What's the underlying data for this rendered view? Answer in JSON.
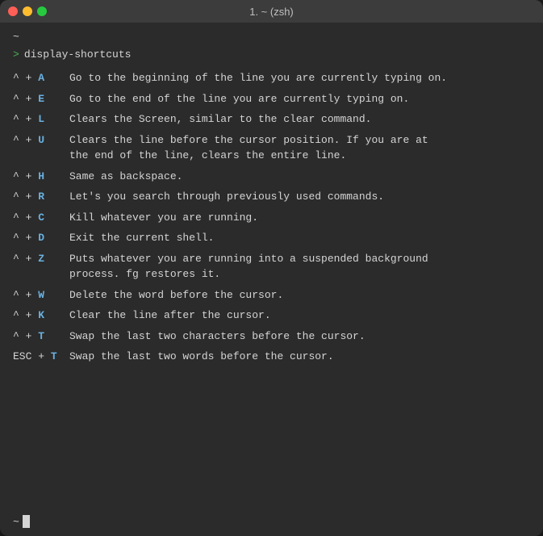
{
  "window": {
    "title": "1. ~ (zsh)"
  },
  "terminal": {
    "tilde": "~",
    "prompt_command": "display-shortcuts",
    "shortcuts": [
      {
        "key_display": "^ + A",
        "key_caret": "^",
        "key_plus": "+",
        "key_letter": "A",
        "key_type": "ctrl",
        "description": "Go to the beginning of the line you are currently typing on.",
        "description2": ""
      },
      {
        "key_display": "^ + E",
        "key_caret": "^",
        "key_plus": "+",
        "key_letter": "E",
        "key_type": "ctrl",
        "description": "Go to the end of the line you are currently typing on.",
        "description2": ""
      },
      {
        "key_display": "^ + L",
        "key_caret": "^",
        "key_plus": "+",
        "key_letter": "L",
        "key_type": "ctrl",
        "description": "Clears the Screen, similar to the clear command.",
        "description2": ""
      },
      {
        "key_display": "^ + U",
        "key_caret": "^",
        "key_plus": "+",
        "key_letter": "U",
        "key_type": "ctrl",
        "description": "Clears the line before the cursor position. If you are at",
        "description2": "the end of the line, clears the entire line."
      },
      {
        "key_display": "^ + H",
        "key_caret": "^",
        "key_plus": "+",
        "key_letter": "H",
        "key_type": "ctrl",
        "description": "Same as backspace.",
        "description2": ""
      },
      {
        "key_display": "^ + R",
        "key_caret": "^",
        "key_plus": "+",
        "key_letter": "R",
        "key_type": "ctrl",
        "description": "Let's you search through previously used commands.",
        "description2": ""
      },
      {
        "key_display": "^ + C",
        "key_caret": "^",
        "key_plus": "+",
        "key_letter": "C",
        "key_type": "ctrl",
        "description": "Kill whatever you are running.",
        "description2": ""
      },
      {
        "key_display": "^ + D",
        "key_caret": "^",
        "key_plus": "+",
        "key_letter": "D",
        "key_type": "ctrl",
        "description": "Exit the current shell.",
        "description2": ""
      },
      {
        "key_display": "^ + Z",
        "key_caret": "^",
        "key_plus": "+",
        "key_letter": "Z",
        "key_type": "ctrl",
        "description": "Puts whatever you are running into a suspended background",
        "description2": "process. fg restores it."
      },
      {
        "key_display": "^ + W",
        "key_caret": "^",
        "key_plus": "+",
        "key_letter": "W",
        "key_type": "ctrl",
        "description": "Delete the word before the cursor.",
        "description2": ""
      },
      {
        "key_display": "^ + K",
        "key_caret": "^",
        "key_plus": "+",
        "key_letter": "K",
        "key_type": "ctrl",
        "description": "Clear the line after the cursor.",
        "description2": ""
      },
      {
        "key_display": "^ + T",
        "key_caret": "^",
        "key_plus": "+",
        "key_letter": "T",
        "key_type": "ctrl",
        "description": "Swap the last two characters before the cursor.",
        "description2": ""
      },
      {
        "key_display": "ESC + T",
        "key_caret": "ESC",
        "key_plus": "+",
        "key_letter": "T",
        "key_type": "esc",
        "description": "Swap the last two words before the cursor.",
        "description2": ""
      }
    ],
    "bottom_tilde": "~"
  }
}
